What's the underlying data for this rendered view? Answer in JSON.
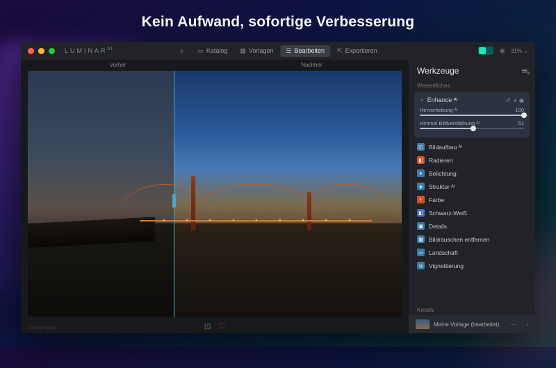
{
  "headline": "Kein Aufwand, sofortige Verbesserung",
  "app": {
    "name": "LUMINAR",
    "suffix": "AI"
  },
  "toolbar": {
    "add": "+",
    "catalog": "Katalog",
    "templates": "Vorlagen",
    "edit": "Bearbeiten",
    "export": "Exportieren",
    "zoom": "31%"
  },
  "compare": {
    "before": "Vorher",
    "after": "Nachher"
  },
  "panel": {
    "title": "Werkzeuge",
    "section_essentials": "Wesentliches",
    "section_creative": "Kreativ",
    "enhance": {
      "name": "Enhance ᴬᴵ",
      "sliders": [
        {
          "label": "Hervorhebung ᴬᴵ",
          "value": 100
        },
        {
          "label": "Himmel Bildverstärkung ᴬᴵ",
          "value": 51
        }
      ]
    },
    "tools": [
      {
        "label": "Bildaufbau ᴬᴵ",
        "color": "#3a7aa8"
      },
      {
        "label": "Radieren",
        "color": "#d4522a"
      },
      {
        "label": "Belichtung",
        "color": "#3a7aa8"
      },
      {
        "label": "Struktur ᴬᴵ",
        "color": "#3a7aa8"
      },
      {
        "label": "Farbe",
        "color": "#d4522a"
      },
      {
        "label": "Schwarz-Weiß",
        "color": "#4a6ac8"
      },
      {
        "label": "Details",
        "color": "#3a7aa8"
      },
      {
        "label": "Bildrauschen entfernen",
        "color": "#3a7aa8"
      },
      {
        "label": "Landschaft",
        "color": "#3a7aa8"
      },
      {
        "label": "Vignettierung",
        "color": "#3a7aa8"
      }
    ]
  },
  "preset": {
    "label": "Meine Vorlage (bearbeitet)"
  },
  "copyright": "© Dima Sytnik"
}
